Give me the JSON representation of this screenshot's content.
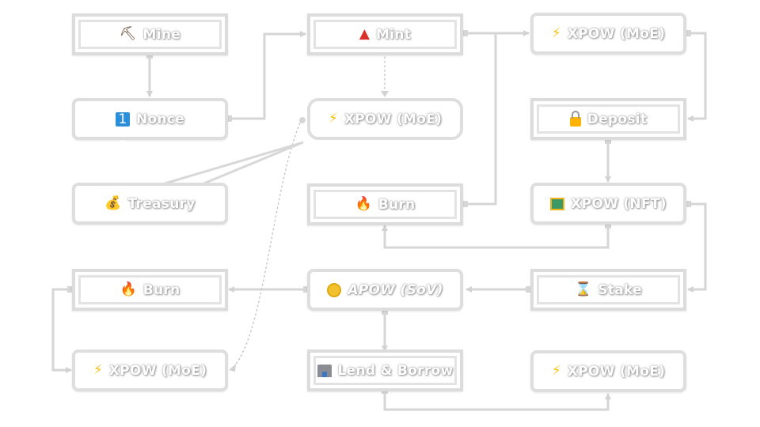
{
  "diagram": {
    "type": "flowchart",
    "colors": {
      "node_border": "#dedede",
      "edge": "#d6d6d6",
      "label_text": "#ffffff",
      "label_outline": "#9a9a9a"
    },
    "nodes": [
      {
        "id": "mine",
        "label": "Mine",
        "icon": "pickaxe-icon",
        "glyph": "⛏",
        "shape": "square"
      },
      {
        "id": "mint",
        "label": "Mint",
        "icon": "red-triangle-icon",
        "glyph": "▲",
        "shape": "square"
      },
      {
        "id": "xpow_moe_1",
        "label": "XPOW (MoE)",
        "icon": "lightning-icon",
        "glyph": "⚡",
        "shape": "round"
      },
      {
        "id": "nonce",
        "label": "Nonce",
        "icon": "numbers-icon",
        "glyph": "1 2 3 4",
        "shape": "round"
      },
      {
        "id": "xpow_moe_2",
        "label": "XPOW (MoE)",
        "icon": "lightning-icon",
        "glyph": "⚡",
        "shape": "octagon"
      },
      {
        "id": "deposit",
        "label": "Deposit",
        "icon": "lock-icon",
        "glyph": "",
        "shape": "square"
      },
      {
        "id": "treasury",
        "label": "Treasury",
        "icon": "money-bag-icon",
        "glyph": "💰",
        "shape": "callout"
      },
      {
        "id": "burn_1",
        "label": "Burn",
        "icon": "fire-icon",
        "glyph": "🔥",
        "shape": "square"
      },
      {
        "id": "xpow_nft",
        "label": "XPOW (NFT)",
        "icon": "picture-icon",
        "glyph": "",
        "shape": "round"
      },
      {
        "id": "burn_2",
        "label": "Burn",
        "icon": "fire-icon",
        "glyph": "🔥",
        "shape": "square"
      },
      {
        "id": "apow_sov",
        "label": "APOW (SoV)",
        "icon": "coin-icon",
        "glyph": "",
        "shape": "round",
        "italic": true
      },
      {
        "id": "stake",
        "label": "Stake",
        "icon": "hourglass-icon",
        "glyph": "⌛",
        "shape": "square"
      },
      {
        "id": "xpow_moe_3",
        "label": "XPOW (MoE)",
        "icon": "lightning-icon",
        "glyph": "⚡",
        "shape": "round"
      },
      {
        "id": "lend_borrow",
        "label": "Lend & Borrow",
        "icon": "bank-icon",
        "glyph": "",
        "shape": "square"
      },
      {
        "id": "xpow_moe_4",
        "label": "XPOW (MoE)",
        "icon": "lightning-icon",
        "glyph": "⚡",
        "shape": "round"
      }
    ],
    "edges": [
      {
        "from": "mine",
        "to": "nonce",
        "style": "solid"
      },
      {
        "from": "nonce",
        "to": "mint",
        "style": "solid"
      },
      {
        "from": "mint",
        "to": "xpow_moe_1",
        "style": "solid"
      },
      {
        "from": "mint",
        "to": "xpow_moe_2",
        "style": "dotted"
      },
      {
        "from": "xpow_moe_1",
        "to": "deposit",
        "style": "solid"
      },
      {
        "from": "deposit",
        "to": "xpow_nft",
        "style": "solid"
      },
      {
        "from": "burn_1",
        "to": "xpow_moe_1",
        "style": "solid"
      },
      {
        "from": "xpow_nft",
        "to": "burn_1",
        "style": "solid"
      },
      {
        "from": "xpow_nft",
        "to": "stake",
        "style": "solid"
      },
      {
        "from": "stake",
        "to": "apow_sov",
        "style": "solid"
      },
      {
        "from": "apow_sov",
        "to": "burn_2",
        "style": "solid"
      },
      {
        "from": "apow_sov",
        "to": "lend_borrow",
        "style": "solid"
      },
      {
        "from": "burn_2",
        "to": "xpow_moe_3",
        "style": "solid"
      },
      {
        "from": "lend_borrow",
        "to": "xpow_moe_4",
        "style": "solid"
      },
      {
        "from": "xpow_moe_2",
        "to": "xpow_moe_3",
        "style": "dotted"
      }
    ]
  }
}
